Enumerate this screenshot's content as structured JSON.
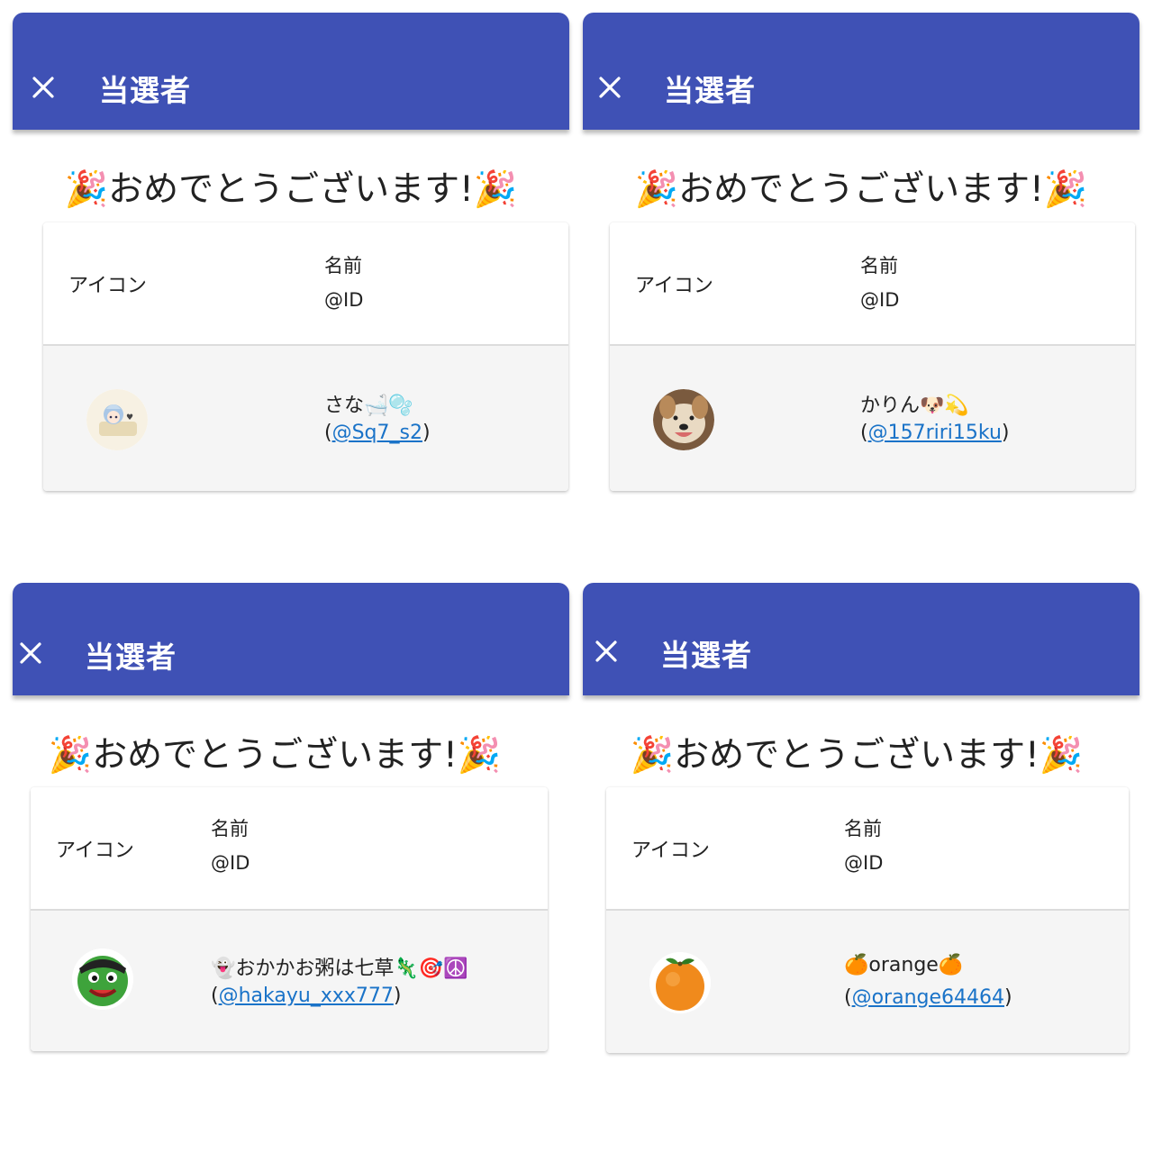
{
  "panels": [
    {
      "title": "当選者",
      "close_icon": "close-icon",
      "congrats": "🎉おめでとうございます!🎉",
      "header_icon_label": "アイコン",
      "header_name_label": "名前",
      "header_id_label": "@ID",
      "winner": {
        "avatar": "bath-character-avatar",
        "name": "さな🛁🫧",
        "id_prefix": "(",
        "id_handle": "@Sq7_s2",
        "id_suffix": ")"
      }
    },
    {
      "title": "当選者",
      "close_icon": "close-icon",
      "congrats": "🎉おめでとうございます!🎉",
      "header_icon_label": "アイコン",
      "header_name_label": "名前",
      "header_id_label": "@ID",
      "winner": {
        "avatar": "dog-photo-avatar",
        "name": "かりん🐶💫",
        "id_prefix": "(",
        "id_handle": "@157riri15ku",
        "id_suffix": ")"
      }
    },
    {
      "title": "当選者",
      "close_icon": "close-icon",
      "congrats": "🎉おめでとうございます!🎉",
      "header_icon_label": "アイコン",
      "header_name_label": "名前",
      "header_id_label": "@ID",
      "winner": {
        "avatar": "green-character-avatar",
        "name": "👻おかかお粥は七草🦎🎯☮️",
        "id_prefix": "(",
        "id_handle": "@hakayu_xxx777",
        "id_suffix": ")"
      }
    },
    {
      "title": "当選者",
      "close_icon": "close-icon",
      "congrats": "🎉おめでとうございます!🎉",
      "header_icon_label": "アイコン",
      "header_name_label": "名前",
      "header_id_label": "@ID",
      "winner": {
        "avatar": "orange-avatar",
        "name": "🍊orange🍊",
        "id_prefix": "(",
        "id_handle": "@orange64464",
        "id_suffix": ")"
      }
    }
  ],
  "colors": {
    "appbar": "#3f51b5",
    "link": "#1a73c8",
    "row_bg": "#f5f5f5"
  }
}
